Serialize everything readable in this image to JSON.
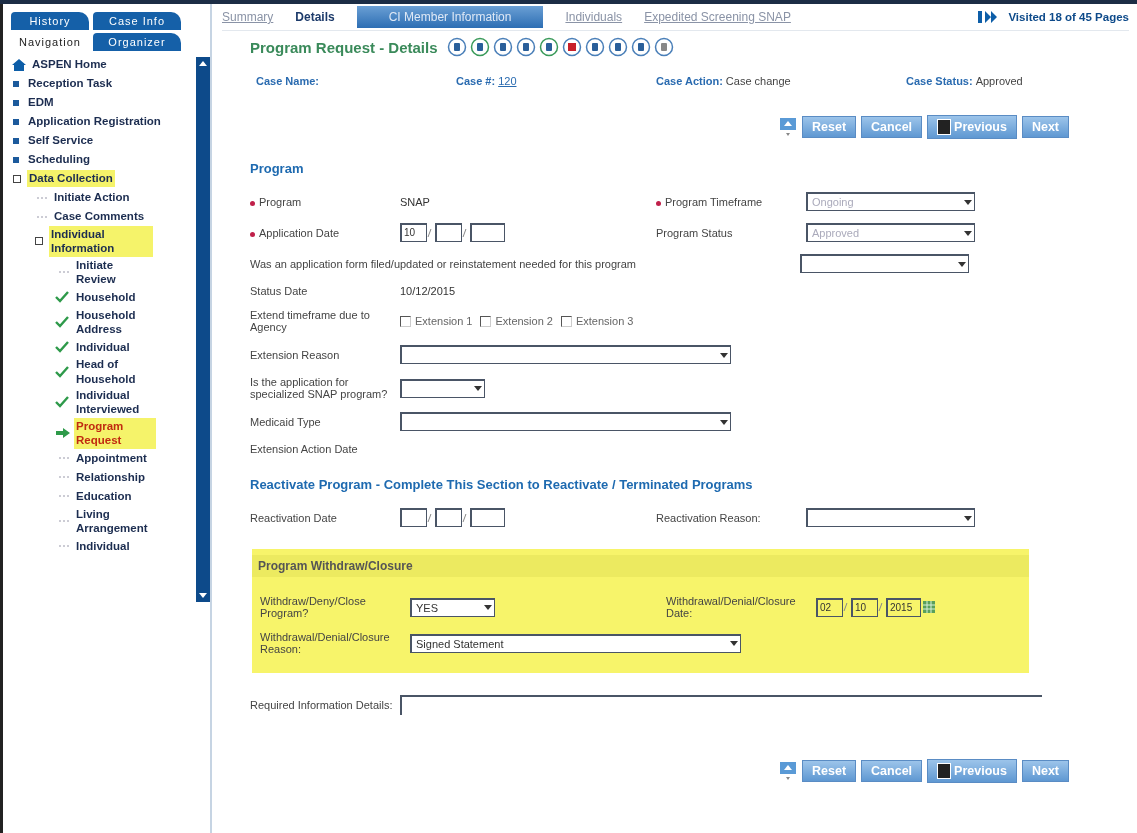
{
  "sidebar": {
    "tabs": [
      {
        "label": "History",
        "selected": false
      },
      {
        "label": "Case Info",
        "selected": false
      },
      {
        "label": "Navigation",
        "selected": true
      },
      {
        "label": "Organizer",
        "selected": false
      }
    ],
    "tree": [
      {
        "label": "ASPEN Home",
        "kind": "home"
      },
      {
        "label": "Reception Task",
        "kind": "bullet"
      },
      {
        "label": "EDM",
        "kind": "bullet"
      },
      {
        "label": "Application Registration",
        "kind": "bullet"
      },
      {
        "label": "Self Service",
        "kind": "bullet"
      },
      {
        "label": "Scheduling",
        "kind": "bullet"
      },
      {
        "label": "Data Collection",
        "kind": "folder",
        "highlighted": true,
        "children": [
          {
            "label": "Initiate Action",
            "kind": "page"
          },
          {
            "label": "Case Comments",
            "kind": "page"
          },
          {
            "label": "Individual Information",
            "kind": "folder",
            "highlighted": true,
            "children": [
              {
                "label": "Initiate Review",
                "kind": "page",
                "checked": false,
                "current": false
              },
              {
                "label": "Household",
                "kind": "page",
                "checked": true,
                "current": false
              },
              {
                "label": "Household Address",
                "kind": "page",
                "checked": true,
                "current": false
              },
              {
                "label": "Individual",
                "kind": "page",
                "checked": true,
                "current": false
              },
              {
                "label": "Head of Household",
                "kind": "page",
                "checked": true,
                "current": false
              },
              {
                "label": "Individual Interviewed",
                "kind": "page",
                "checked": true,
                "current": false
              },
              {
                "label": "Program Request",
                "kind": "page",
                "checked": false,
                "current": true,
                "highlighted": true
              },
              {
                "label": "Appointment",
                "kind": "page",
                "checked": false,
                "current": false
              },
              {
                "label": "Relationship",
                "kind": "page",
                "checked": false,
                "current": false
              },
              {
                "label": "Education",
                "kind": "page",
                "checked": false,
                "current": false
              },
              {
                "label": "Living Arrangement",
                "kind": "page",
                "checked": false,
                "current": false
              },
              {
                "label": "Individual",
                "kind": "page",
                "checked": false,
                "current": false
              }
            ]
          }
        ]
      }
    ]
  },
  "page_tabs": [
    {
      "label": "Summary",
      "kind": "link",
      "selected": false
    },
    {
      "label": "Details",
      "kind": "link",
      "selected": true
    },
    {
      "label": "CI Member Information",
      "kind": "button",
      "selected": false
    },
    {
      "label": "Individuals",
      "kind": "link",
      "selected": false
    },
    {
      "label": "Expedited Screening SNAP",
      "kind": "link",
      "selected": false
    }
  ],
  "visited": "Visited 18 of 45 Pages",
  "title": "Program Request - Details",
  "case_info": [
    {
      "label": "Case Name:",
      "kind": "text"
    },
    {
      "label": "Case #:",
      "value": "120",
      "kind": "link"
    },
    {
      "label": "Case Action:",
      "value": "Case change",
      "kind": "text"
    },
    {
      "label": "Case Status:",
      "value": "Approved",
      "kind": "text"
    }
  ],
  "buttons": [
    "Reset",
    "Cancel",
    "Previous",
    "Next"
  ],
  "sections": [
    {
      "title": "Program",
      "highlighted": false,
      "rows": [
        {
          "kind": "pair",
          "fields": [
            {
              "label": "Program",
              "required": true,
              "control": {
                "kind": "value",
                "value": "SNAP"
              }
            },
            {
              "label": "Program Timeframe",
              "required": true,
              "control": {
                "kind": "select",
                "value": "Ongoing",
                "disabled": true
              }
            }
          ]
        },
        {
          "kind": "pair",
          "fields": [
            {
              "label": "Application Date",
              "required": true,
              "control": {
                "kind": "date",
                "month": "10"
              }
            },
            {
              "label": "Program Status",
              "required": false,
              "control": {
                "kind": "select",
                "value": "Approved",
                "disabled": true
              }
            }
          ]
        },
        {
          "kind": "long",
          "fields": [
            {
              "label": "Was an application form filed/updated or reinstatement needed for this program",
              "required": false,
              "control": {
                "kind": "select",
                "disabled": false
              }
            }
          ]
        },
        {
          "kind": "pair",
          "fields": [
            {
              "label": "Status Date",
              "required": false,
              "control": {
                "kind": "value",
                "value": "10/12/2015"
              }
            }
          ]
        },
        {
          "kind": "pair",
          "fields": [
            {
              "label": "Extend timeframe due to Agency",
              "required": false,
              "control": {
                "kind": "checkboxes",
                "options": [
                  {
                    "label": "Extension 1",
                    "checked": false
                  },
                  {
                    "label": "Extension 2",
                    "checked": false
                  },
                  {
                    "label": "Extension 3",
                    "checked": false
                  }
                ]
              }
            }
          ]
        },
        {
          "kind": "pair",
          "fields": [
            {
              "label": "Extension Reason",
              "required": false,
              "control": {
                "kind": "wide-select",
                "disabled": false
              }
            }
          ]
        },
        {
          "kind": "pair",
          "fields": [
            {
              "label": "Is the application for specialized SNAP program?",
              "required": false,
              "control": {
                "kind": "short-select",
                "disabled": false
              }
            }
          ]
        },
        {
          "kind": "pair",
          "fields": [
            {
              "label": "Medicaid Type",
              "required": false,
              "control": {
                "kind": "wide-select",
                "disabled": false
              }
            }
          ]
        },
        {
          "kind": "pair",
          "fields": [
            {
              "label": "Extension Action Date",
              "required": false,
              "control": {
                "kind": "none"
              }
            }
          ]
        }
      ]
    },
    {
      "title": "Reactivate Program - Complete This Section to Reactivate / Terminated Programs",
      "highlighted": false,
      "rows": [
        {
          "kind": "pair",
          "fields": [
            {
              "label": "Reactivation Date",
              "required": false,
              "control": {
                "kind": "date"
              }
            },
            {
              "label": "Reactivation Reason:",
              "required": false,
              "control": {
                "kind": "select",
                "disabled": false
              }
            }
          ]
        }
      ]
    },
    {
      "title": "Program Withdraw/Closure",
      "highlighted": true,
      "rows": [
        {
          "kind": "pair",
          "fields": [
            {
              "label": "Withdraw/Deny/Close Program?",
              "required": false,
              "control": {
                "kind": "short-select",
                "value": "YES",
                "disabled": false
              }
            },
            {
              "label": "Withdrawal/Denial/Closure Date:",
              "required": false,
              "control": {
                "kind": "date",
                "month": "02",
                "day": "10",
                "year": "2015",
                "calendar": true
              }
            }
          ]
        },
        {
          "kind": "pair",
          "fields": [
            {
              "label": "Withdrawal/Denial/Closure Reason:",
              "required": false,
              "control": {
                "kind": "wide-select",
                "value": "Signed Statement",
                "disabled": false
              }
            }
          ]
        }
      ]
    },
    {
      "highlighted": false,
      "rows": [
        {
          "kind": "pair",
          "fields": [
            {
              "label": "Required Information Details:",
              "required": false,
              "control": {
                "kind": "textarea"
              }
            }
          ]
        }
      ]
    }
  ],
  "bottom_buttons": [
    "Reset",
    "Cancel",
    "Previous",
    "Next"
  ]
}
